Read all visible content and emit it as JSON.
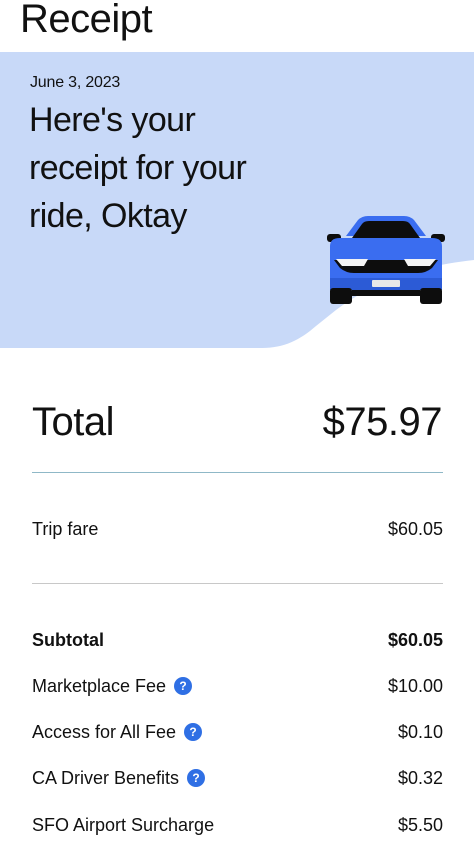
{
  "header": {
    "title": "Receipt"
  },
  "hero": {
    "date": "June 3, 2023",
    "heading": "Here's your receipt for your ride, Oktay",
    "background_color": "#c8d9f8"
  },
  "summary": {
    "total_label": "Total",
    "total_value": "$75.97"
  },
  "fare": {
    "label": "Trip fare",
    "value": "$60.05"
  },
  "breakdown": [
    {
      "label": "Subtotal",
      "value": "$60.05",
      "bold": true,
      "info": false
    },
    {
      "label": "Marketplace Fee",
      "value": "$10.00",
      "bold": false,
      "info": true
    },
    {
      "label": "Access for All Fee",
      "value": "$0.10",
      "bold": false,
      "info": true
    },
    {
      "label": "CA Driver Benefits",
      "value": "$0.32",
      "bold": false,
      "info": true
    },
    {
      "label": "SFO Airport Surcharge",
      "value": "$5.50",
      "bold": false,
      "info": false
    }
  ],
  "icons": {
    "info": "question-mark-circle-icon",
    "car": "car-icon"
  },
  "colors": {
    "accent_blue": "#2f6fe4",
    "car_blue": "#3a6df0"
  }
}
